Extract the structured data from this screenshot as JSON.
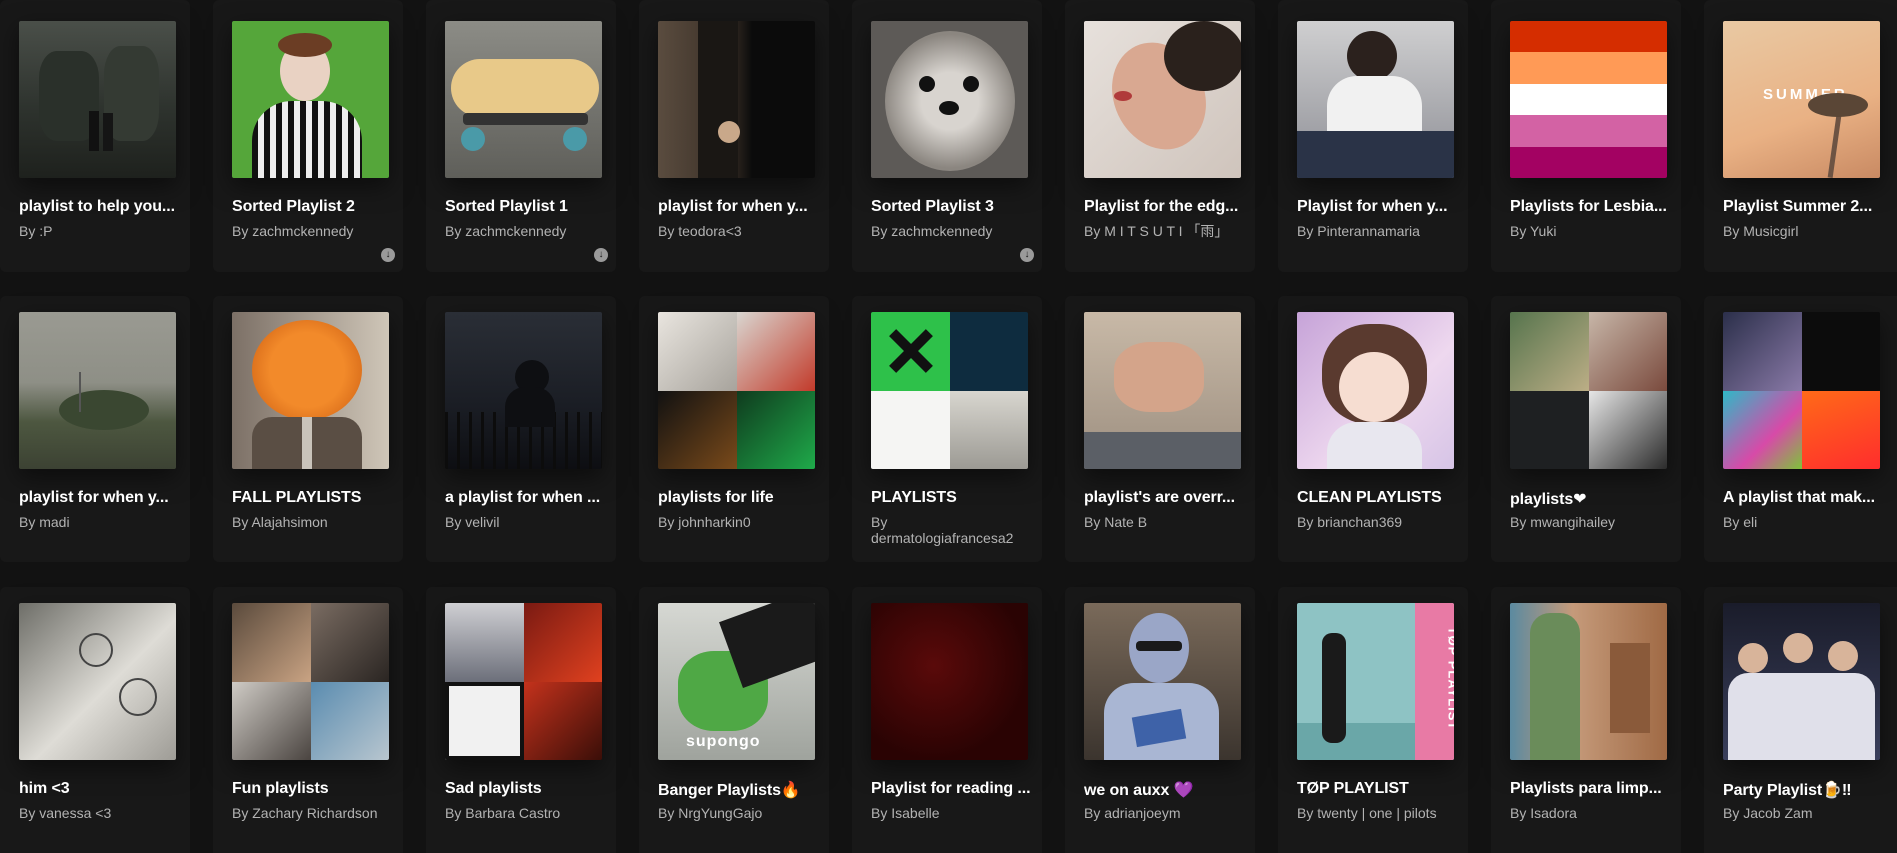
{
  "playlists": [
    {
      "title": "playlist to help you...",
      "author": "By :P"
    },
    {
      "title": "Sorted Playlist 2",
      "author": "By zachmckennedy"
    },
    {
      "title": "Sorted Playlist 1",
      "author": "By zachmckennedy"
    },
    {
      "title": "playlist for when y...",
      "author": "By teodora<3"
    },
    {
      "title": "Sorted Playlist 3",
      "author": "By zachmckennedy"
    },
    {
      "title": "Playlist for the edg...",
      "author": "By M I T S U T I 「雨」"
    },
    {
      "title": "Playlist for when y...",
      "author": "By Pinterannamaria"
    },
    {
      "title": "Playlists for Lesbia...",
      "author": "By Yuki"
    },
    {
      "title": "Playlist Summer 2...",
      "author": "By Musicgirl",
      "cover_text": "SUMMER"
    },
    {
      "title": "playlist for when y...",
      "author": "By madi"
    },
    {
      "title": "FALL PLAYLISTS",
      "author": "By Alajahsimon"
    },
    {
      "title": "a playlist for when ...",
      "author": "By velivil"
    },
    {
      "title": "playlists for life",
      "author": "By johnharkin0"
    },
    {
      "title": "PLAYLISTS",
      "author": "By dermatologiafrancesa2"
    },
    {
      "title": "playlist's are overr...",
      "author": "By Nate B"
    },
    {
      "title": "CLEAN PLAYLISTS",
      "author": "By brianchan369"
    },
    {
      "title": "playlists❤",
      "author": "By mwangihailey"
    },
    {
      "title": "A playlist that mak...",
      "author": "By eli"
    },
    {
      "title": "him <3",
      "author": "By vanessa <3"
    },
    {
      "title": "Fun playlists",
      "author": "By Zachary Richardson"
    },
    {
      "title": "Sad playlists",
      "author": "By Barbara Castro"
    },
    {
      "title": "Banger Playlists🔥",
      "author": "By NrgYungGajo",
      "cover_text": "supongo"
    },
    {
      "title": "Playlist for reading ...",
      "author": "By Isabelle"
    },
    {
      "title": "we on auxx 💜",
      "author": "By adrianjoeym"
    },
    {
      "title": "TØP PLAYLIST",
      "author": "By twenty | one | pilots",
      "cover_text": "TØP PLAYLIST"
    },
    {
      "title": "Playlists para limp...",
      "author": "By Isadora"
    },
    {
      "title": "Party Playlist🍺‼",
      "author": "By Jacob Zam"
    }
  ],
  "icons": {
    "download": "download-arrow-icon"
  },
  "colors": {
    "background": "#121212",
    "card": "#181818",
    "subtext": "#b3b3b3"
  }
}
